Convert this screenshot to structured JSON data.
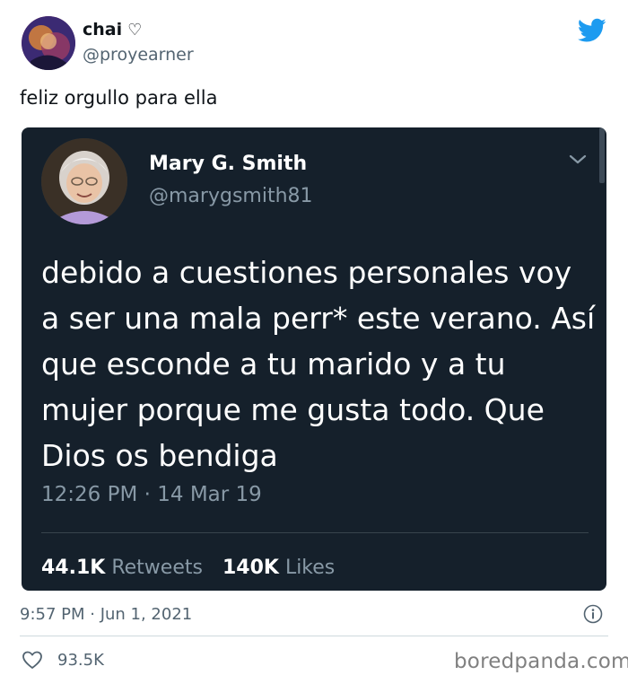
{
  "tweet": {
    "author_name": "chai",
    "heart_glyph": "♡",
    "author_handle": "@proyearner",
    "text": "feliz orgullo para ella",
    "timestamp": "9:57 PM · Jun 1, 2021",
    "likes": "93.5K"
  },
  "quoted": {
    "name": "Mary G. Smith",
    "handle": "@marygsmith81",
    "text": "debido a cuestiones personales voy a ser una mala perr* este verano. Así que esconde a tu marido y a tu mujer porque me gusta todo. Que Dios os bendiga",
    "timestamp": "12:26 PM · 14 Mar 19",
    "retweets_count": "44.1K",
    "retweets_label": "Retweets",
    "likes_count": "140K",
    "likes_label": "Likes"
  },
  "watermark": "boredpanda.com",
  "colors": {
    "twitter_blue": "#1d9bf0",
    "dark_bg": "#15202b",
    "muted": "#536471"
  }
}
